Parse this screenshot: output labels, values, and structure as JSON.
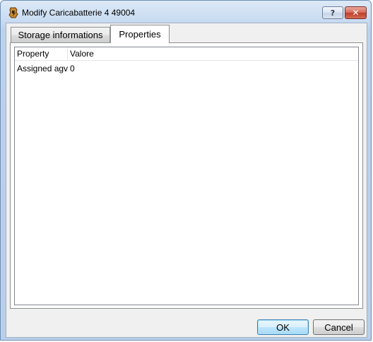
{
  "window": {
    "title": "Modify Caricabatterie 4 49004",
    "help_glyph": "?",
    "close_glyph": "✕"
  },
  "tabs": [
    {
      "label": "Storage informations",
      "selected": false
    },
    {
      "label": "Properties",
      "selected": true
    }
  ],
  "grid": {
    "columns": [
      "Property",
      "Valore"
    ],
    "rows": [
      {
        "property": "Assigned agv",
        "value": "0"
      }
    ]
  },
  "buttons": {
    "ok_label": "OK",
    "cancel_label": "Cancel"
  },
  "colors": {
    "title_bar": "#c9dcf1",
    "close_button": "#c0402a",
    "default_button_border": "#3c7fb1"
  }
}
